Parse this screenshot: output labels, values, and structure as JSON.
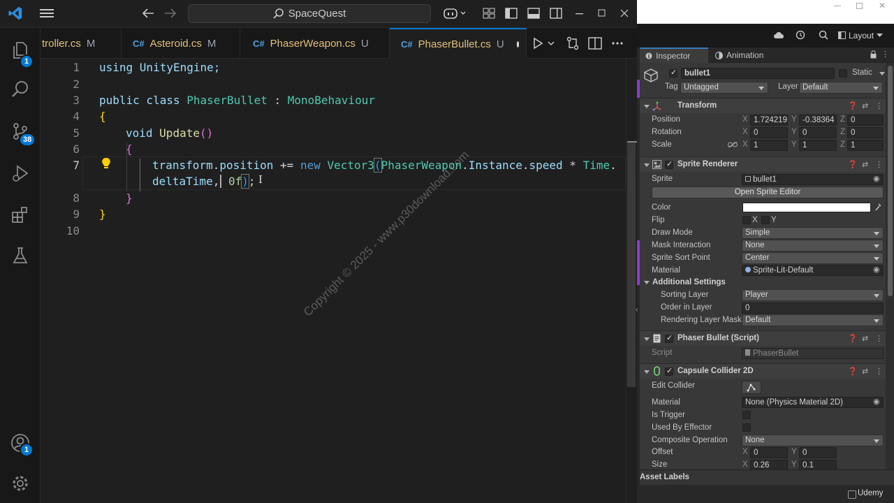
{
  "vscode": {
    "search_text": "SpaceQuest",
    "tabs": [
      {
        "label": "troller.cs",
        "status": "M",
        "icon": "csharp-icon"
      },
      {
        "label": "Asteroid.cs",
        "status": "M",
        "icon": "csharp-icon"
      },
      {
        "label": "PhaserWeapon.cs",
        "status": "U",
        "icon": "csharp-icon"
      },
      {
        "label": "PhaserBullet.cs",
        "status": "U",
        "icon": "csharp-icon",
        "active": true,
        "dirty": true
      }
    ],
    "badges": {
      "explorer": "1",
      "source_control": "38",
      "accounts": "1"
    },
    "line_numbers": [
      "1",
      "2",
      "3",
      "4",
      "5",
      "6",
      "7",
      "",
      "8",
      "9",
      "10"
    ],
    "code": {
      "l1": "using UnityEngine;",
      "l3_kw": "public class",
      "l3_name": "PhaserBullet",
      "l3_sep": " : ",
      "l3_base": "MonoBehaviour",
      "l4": "{",
      "l5_kw": "void",
      "l5_fn": "Update",
      "l5_par": "()",
      "l6": "{",
      "l7_a": "transform",
      "l7_b": "position",
      "l7_op": " += ",
      "l7_new": "new",
      "l7_type": "Vector3",
      "l7_c": "PhaserWeapon",
      "l7_d": "Instance",
      "l7_e": "speed",
      "l7_f": "Time",
      "l7w_a": "deltaTime",
      "l7w_num": "0f",
      "l8": "}",
      "l9": "}"
    },
    "watermark": "Copyright © 2025 - www.p30download.com"
  },
  "unity": {
    "layout_label": "Layout",
    "tabs": {
      "inspector": "Inspector",
      "animation": "Animation"
    },
    "object": {
      "name": "bullet1",
      "static_label": "Static",
      "tag_label": "Tag",
      "tag_value": "Untagged",
      "layer_label": "Layer",
      "layer_value": "Default"
    },
    "transform": {
      "title": "Transform",
      "position_label": "Position",
      "pos_x": "1.724219",
      "pos_y": "-0.38364",
      "pos_z": "0",
      "rotation_label": "Rotation",
      "rot_x": "0",
      "rot_y": "0",
      "rot_z": "0",
      "scale_label": "Scale",
      "scale_x": "1",
      "scale_y": "1",
      "scale_z": "1"
    },
    "sprite_renderer": {
      "title": "Sprite Renderer",
      "sprite_label": "Sprite",
      "sprite_value": "bullet1",
      "open_editor": "Open Sprite Editor",
      "color_label": "Color",
      "flip_label": "Flip",
      "flip_x": "X",
      "flip_y": "Y",
      "draw_mode_label": "Draw Mode",
      "draw_mode": "Simple",
      "mask_label": "Mask Interaction",
      "mask": "None",
      "sort_point_label": "Sprite Sort Point",
      "sort_point": "Center",
      "material_label": "Material",
      "material": "Sprite-Lit-Default",
      "additional": "Additional Settings",
      "sorting_layer_label": "Sorting Layer",
      "sorting_layer": "Player",
      "order_label": "Order in Layer",
      "order": "0",
      "rlm_label": "Rendering Layer Mask",
      "rlm": "Default"
    },
    "script_comp": {
      "title": "Phaser Bullet (Script)",
      "script_label": "Script",
      "script_value": "PhaserBullet"
    },
    "collider": {
      "title": "Capsule Collider 2D",
      "edit_label": "Edit Collider",
      "material_label": "Material",
      "material": "None (Physics Material 2D)",
      "trigger_label": "Is Trigger",
      "effector_label": "Used By Effector",
      "composite_label": "Composite Operation",
      "composite": "None",
      "offset_label": "Offset",
      "offset_x": "0",
      "offset_y": "0",
      "size_label": "Size",
      "size_x": "0.26",
      "size_y": "0.1"
    },
    "asset_labels": "Asset Labels",
    "udemy": "Udemy",
    "axis": {
      "x": "X",
      "y": "Y",
      "z": "Z"
    }
  }
}
